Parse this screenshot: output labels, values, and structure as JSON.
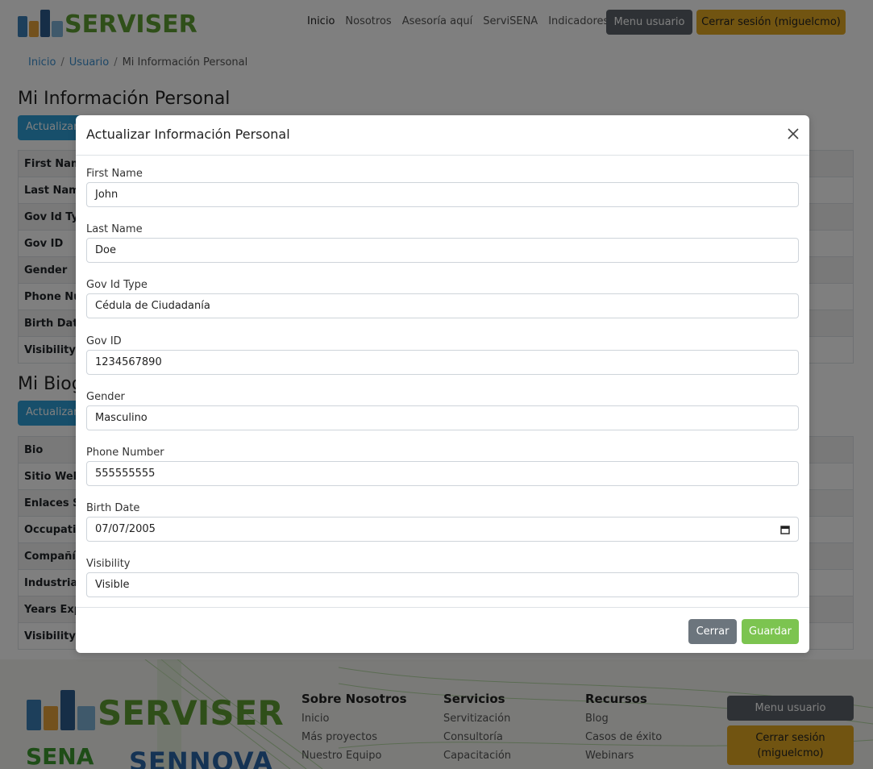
{
  "brand": {
    "name": "SERVISER",
    "color": "#5e9e33"
  },
  "nav": {
    "links": [
      "Inicio",
      "Nosotros",
      "Asesoría aquí",
      "ServiSENA",
      "Indicadores"
    ],
    "menu_usuario": "Menu usuario",
    "cerrar_sesion": "Cerrar sesión (miguelcmo)"
  },
  "breadcrumb": {
    "items": [
      "Inicio",
      "Usuario",
      "Mi Información Personal"
    ],
    "separator": "/"
  },
  "page": {
    "heading1": "Mi Información Personal",
    "update_btn1": "Actualizar",
    "table1_keys": [
      "First Name",
      "Last Name",
      "Gov Id Type",
      "Gov ID",
      "Gender",
      "Phone Number",
      "Birth Date",
      "Visibility"
    ],
    "heading2": "Mi Biografía",
    "update_btn2": "Actualizar",
    "table2_keys": [
      "Bio",
      "Sitio Web",
      "Enlaces Sociales",
      "Occupation",
      "Compañía",
      "Industria",
      "Years Experience",
      "Visibility"
    ]
  },
  "modal": {
    "title": "Actualizar Información Personal",
    "close_icon": "close-icon",
    "fields": [
      {
        "label": "First Name",
        "value": "John"
      },
      {
        "label": "Last Name",
        "value": "Doe"
      },
      {
        "label": "Gov Id Type",
        "value": "Cédula de Ciudadanía"
      },
      {
        "label": "Gov ID",
        "value": "1234567890"
      },
      {
        "label": "Gender",
        "value": "Masculino"
      },
      {
        "label": "Phone Number",
        "value": "555555555"
      },
      {
        "label": "Birth Date",
        "value": "07/07/2005"
      },
      {
        "label": "Visibility",
        "value": "Visible"
      }
    ],
    "cerrar": "Cerrar",
    "guardar": "Guardar"
  },
  "footer": {
    "brand": "SERVISER",
    "sena": "SENA",
    "sennova": "SENNOVA",
    "cols": [
      {
        "title": "Sobre Nosotros",
        "items": [
          "Inicio",
          "Más proyectos",
          "Nuestro Equipo"
        ]
      },
      {
        "title": "Servicios",
        "items": [
          "Servitización",
          "Consultoría",
          "Capacitación"
        ]
      },
      {
        "title": "Recursos",
        "items": [
          "Blog",
          "Casos de éxito",
          "Webinars"
        ]
      }
    ],
    "menu_usuario": "Menu usuario",
    "cerrar_sesion": "Cerrar sesión (miguelcmo)"
  },
  "colors": {
    "primary": "#2f9fd6",
    "warning": "#e3a822",
    "secondary": "#6c757d",
    "success": "#7cc450"
  }
}
